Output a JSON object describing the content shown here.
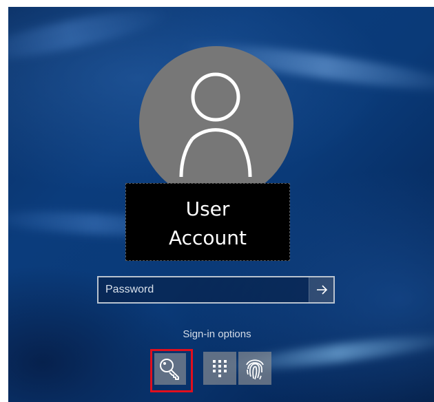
{
  "user": {
    "name_line1": "User",
    "name_line2": "Account"
  },
  "password": {
    "placeholder": "Password",
    "value": "",
    "submit_icon": "arrow-right-icon"
  },
  "signin_options": {
    "label": "Sign-in options",
    "options": [
      {
        "icon": "key-icon",
        "selected": true
      },
      {
        "icon": "pin-keypad-icon",
        "selected": false
      },
      {
        "icon": "fingerprint-icon",
        "selected": false
      }
    ]
  },
  "colors": {
    "background": "#0b3c7c",
    "avatar": "#777777",
    "highlight": "#e10f1d"
  }
}
